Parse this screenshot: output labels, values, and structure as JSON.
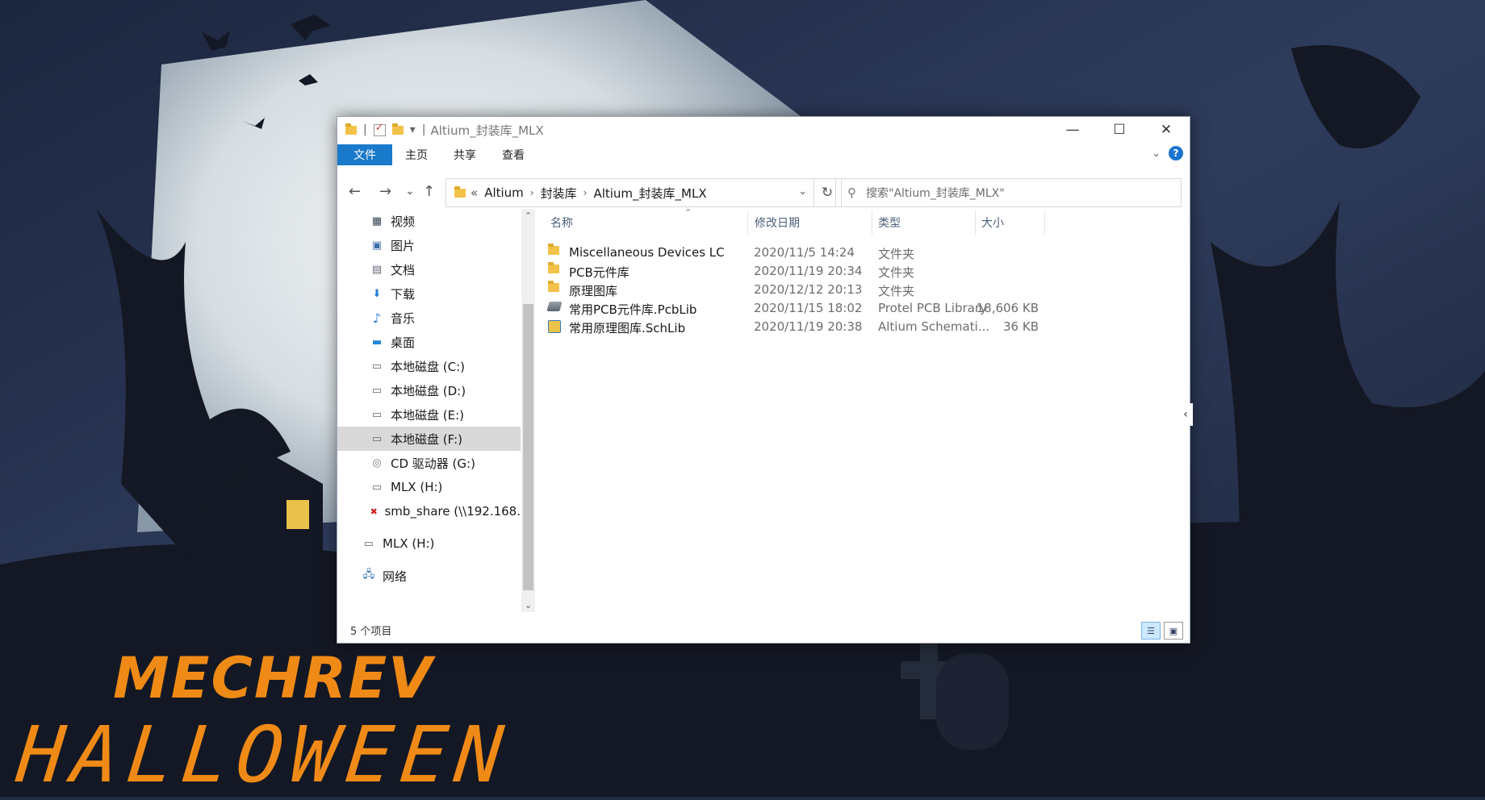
{
  "wallpaper": {
    "brand": "MECHREV",
    "headline": "HALLOWEEN",
    "colors": {
      "sky": "#26334f",
      "moon": "#e8eef0",
      "silhouette": "#141824",
      "accent": "#f08a16"
    }
  },
  "window": {
    "title": "Altium_封装库_MLX",
    "controls": {
      "minimize": "—",
      "maximize": "☐",
      "close": "✕"
    },
    "ribbon_tabs": [
      "文件",
      "主页",
      "共享",
      "查看"
    ],
    "help_label": "?",
    "nav_buttons": {
      "back": "←",
      "forward": "→",
      "recent": "⌄",
      "up": "↑"
    },
    "address": {
      "prefix": "«",
      "crumbs": [
        "Altium",
        "封装库",
        "Altium_封装库_MLX"
      ],
      "separator": "›"
    },
    "search": {
      "placeholder": "搜索\"Altium_封装库_MLX\""
    },
    "nav_pane": [
      {
        "label": "视频",
        "icon": "video-folder-icon",
        "glyph": "▦"
      },
      {
        "label": "图片",
        "icon": "pictures-folder-icon",
        "glyph": "▣"
      },
      {
        "label": "文档",
        "icon": "documents-folder-icon",
        "glyph": "▤"
      },
      {
        "label": "下载",
        "icon": "downloads-folder-icon",
        "glyph": "⬇"
      },
      {
        "label": "音乐",
        "icon": "music-folder-icon",
        "glyph": "♪"
      },
      {
        "label": "桌面",
        "icon": "desktop-folder-icon",
        "glyph": "▬"
      },
      {
        "label": "本地磁盘 (C:)",
        "icon": "system-drive-icon",
        "glyph": "▭"
      },
      {
        "label": "本地磁盘 (D:)",
        "icon": "drive-icon",
        "glyph": "▭"
      },
      {
        "label": "本地磁盘 (E:)",
        "icon": "drive-icon",
        "glyph": "▭"
      },
      {
        "label": "本地磁盘 (F:)",
        "icon": "drive-icon",
        "glyph": "▭",
        "selected": true
      },
      {
        "label": "CD 驱动器 (G:)",
        "icon": "cd-drive-icon",
        "glyph": "◎"
      },
      {
        "label": "MLX (H:)",
        "icon": "usb-drive-icon",
        "glyph": "▭"
      },
      {
        "label": "smb_share (\\\\192.168.",
        "icon": "network-drive-disconnected-icon",
        "glyph": "✖"
      },
      {
        "label": "MLX (H:)",
        "icon": "usb-drive-icon",
        "glyph": "▭"
      },
      {
        "label": "网络",
        "icon": "network-icon",
        "glyph": "🖧"
      }
    ],
    "columns": {
      "name": "名称",
      "modified": "修改日期",
      "type": "类型",
      "size": "大小"
    },
    "files": [
      {
        "name": "Miscellaneous Devices LC",
        "modified": "2020/11/5 14:24",
        "type": "文件夹",
        "size": "",
        "icon": "folder-icon"
      },
      {
        "name": "PCB元件库",
        "modified": "2020/11/19 20:34",
        "type": "文件夹",
        "size": "",
        "icon": "folder-icon"
      },
      {
        "name": "原理图库",
        "modified": "2020/12/12 20:13",
        "type": "文件夹",
        "size": "",
        "icon": "folder-icon"
      },
      {
        "name": "常用PCB元件库.PcbLib",
        "modified": "2020/11/15 18:02",
        "type": "Protel PCB Library",
        "size": "18,606 KB",
        "icon": "pcblib-file-icon"
      },
      {
        "name": "常用原理图库.SchLib",
        "modified": "2020/11/19 20:38",
        "type": "Altium Schemati...",
        "size": "36 KB",
        "icon": "schlib-file-icon"
      }
    ],
    "status": "5 个项目",
    "accent_color": "#1979ca"
  }
}
